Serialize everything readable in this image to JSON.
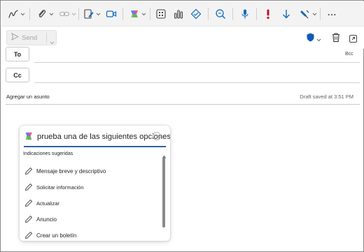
{
  "toolbar": {
    "icons": [
      "draw-icon",
      "attach-icon",
      "link-icon",
      "signature-icon",
      "teams-meeting-icon",
      "copilot-icon",
      "apps-icon",
      "insights-icon",
      "sensitivity-icon",
      "immersive-reader-icon",
      "dictate-icon",
      "high-importance-icon",
      "low-importance-icon",
      "format-painter-icon",
      "more-options-icon"
    ],
    "more_label": "..."
  },
  "send": {
    "label": "Send"
  },
  "fields": {
    "to_label": "To",
    "cc_label": "Cc",
    "bcc_label": "Bcc",
    "subject_placeholder": "Agregar un asunto",
    "draft_status": "Draft saved at 3:51 PM"
  },
  "copilot": {
    "input_text": "prueba una de las siguientes opciones",
    "section_title": "Indicaciones sugeridas",
    "suggestions": [
      "Mensaje breve y descriptivo",
      "Solicitar información",
      "Actualizar",
      "Anuncio",
      "Crear un boletín"
    ]
  },
  "colors": {
    "accent": "#0f6cbd",
    "importance_red": "#c50f1f",
    "copilot_underline": "#2f5fa7"
  }
}
